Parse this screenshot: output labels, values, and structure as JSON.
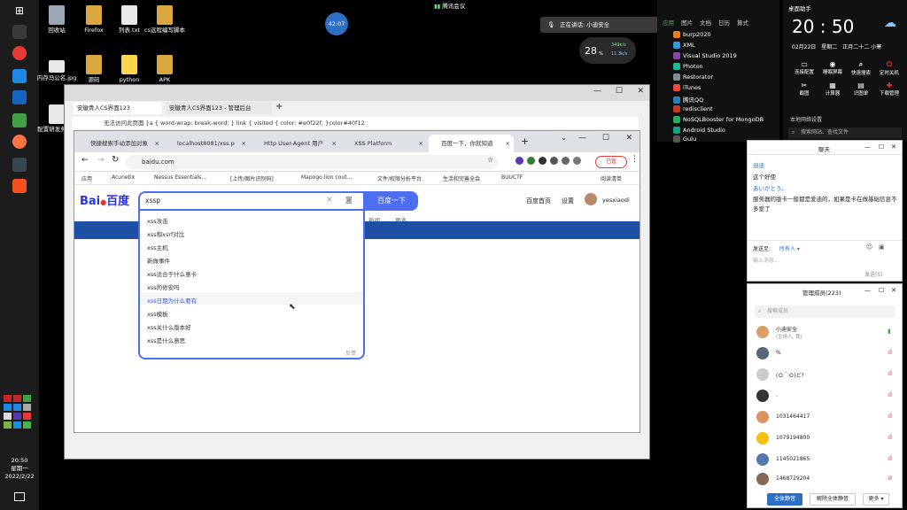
{
  "desktop": {
    "icons": [
      {
        "label": "回收站"
      },
      {
        "label": "Firefox"
      },
      {
        "label": "列表.txt"
      },
      {
        "label": "cs远程编写脚本"
      },
      {
        "label": "内存马公名.jpg"
      },
      {
        "label": "源码"
      },
      {
        "label": "python"
      },
      {
        "label": "APK"
      },
      {
        "label": "配置研发务.txt"
      }
    ],
    "clock": {
      "time": "20:50",
      "weekday": "星期一",
      "date": "2022/2/22"
    }
  },
  "meeting": {
    "title": "腾讯会议",
    "timer": "42:07",
    "speaking": "正在讲话: 小迪安全"
  },
  "netmon": {
    "value": "28",
    "unit": "%",
    "up": "349k/s",
    "down": "11.3k/s"
  },
  "outer_window": {
    "tabs": [
      "安徽青人CS界面123",
      "安徽青人CS界面123 - 管理后台"
    ],
    "url_text": "无法访问此页面 }a { word-wrap: break-word; } link { visited { color: #e0f22f; }color#40f12"
  },
  "browser": {
    "tabs": [
      "快捷搜索手动添加对象",
      "localhost8081/xss.p",
      "Http User-Agent 用户",
      "XSS Platform",
      "百度一下，你就知道"
    ],
    "url": "baidu.com",
    "pause_label": "已暂",
    "bookmarks": [
      "应用",
      "Acunetix",
      "Nessus Essentials...",
      "[上传/图片识别码]",
      "Mapogo lion cout...",
      "文件/权限分析平台",
      "生活和完善全会",
      "BUUCTF",
      "阅读清单"
    ],
    "baidu": {
      "logo_a": "Bai",
      "logo_b": "百度",
      "query": "xssp",
      "search_button": "百度一下",
      "links": [
        "百度首页",
        "设置"
      ],
      "user": "yesxiaodi",
      "extra": [
        "新闻",
        "更多"
      ],
      "suggestions": [
        "xss攻击",
        "xss和xsrf对比",
        "xss主机",
        "新做事件",
        "xss适合于什么意卡",
        "xss的修安吗",
        "xss日期为什么要有",
        "xss模板",
        "xss关什么版本好",
        "xss是什么意思"
      ],
      "feedback": "反馈"
    }
  },
  "app_list": {
    "tabs": [
      "应用",
      "图片",
      "文档",
      "日历",
      "算式"
    ],
    "items": [
      "burp2020",
      "XML",
      "Visual Studio 2019",
      "Photon",
      "Restorator",
      "iTunes",
      "腾讯QQ",
      "redisclient",
      "NoSQLBooster for MongoDB",
      "Android Studio",
      "Gulu"
    ],
    "colors": [
      "#e67e22",
      "#3498db",
      "#8e44ad",
      "#1abc9c",
      "#7f8c8d",
      "#e74c3c",
      "#2980b9",
      "#c0392b",
      "#27ae60",
      "#16a085",
      "#555555"
    ]
  },
  "clock_widget": {
    "title": "桌面助手",
    "time": "20 : 50",
    "date": "02月22日",
    "weekday": "星期二",
    "lunar": "正月二十二 小寒",
    "tools": [
      "连接配置",
      "睡眠屏幕",
      "快速搜索",
      "定时关机",
      "截图",
      "计算器",
      "识图单",
      "下载管理"
    ],
    "menu": "本地网络设置",
    "search": "搜索网站、查找文件"
  },
  "chat": {
    "title": "聊天",
    "messages": [
      {
        "sender": "迪迪",
        "text": "这个好使"
      },
      {
        "sender": "",
        "text": "あいがとう。"
      },
      {
        "sender": "",
        "text": "服务器的版卡一般都是爱迪的，如果是卡在做基础信息不多爱了"
      }
    ],
    "to_label": "发送至:",
    "to_value": "所有人",
    "input_placeholder": "输入消息...",
    "send": "发送(S)"
  },
  "members": {
    "title": "管理成员(223)",
    "search_placeholder": "搜索成员",
    "list": [
      {
        "name": "小迪安全",
        "sub": "(主持人, 我)",
        "color": "#d9a066"
      },
      {
        "name": "%",
        "sub": "",
        "color": "#556677"
      },
      {
        "name": "(Ｏ＾Ｏ)ど?",
        "sub": "",
        "color": "#cccccc"
      },
      {
        "name": ".",
        "sub": "",
        "color": "#333333"
      },
      {
        "name": "1031464417",
        "sub": "",
        "color": "#e09060"
      },
      {
        "name": "1079194800",
        "sub": "",
        "color": "#f4c20d"
      },
      {
        "name": "1145021865",
        "sub": "",
        "color": "#5577aa"
      },
      {
        "name": "1468729204",
        "sub": "",
        "color": "#886655"
      }
    ],
    "buttons": [
      "全体静音",
      "解除全体静音",
      "更多"
    ]
  }
}
